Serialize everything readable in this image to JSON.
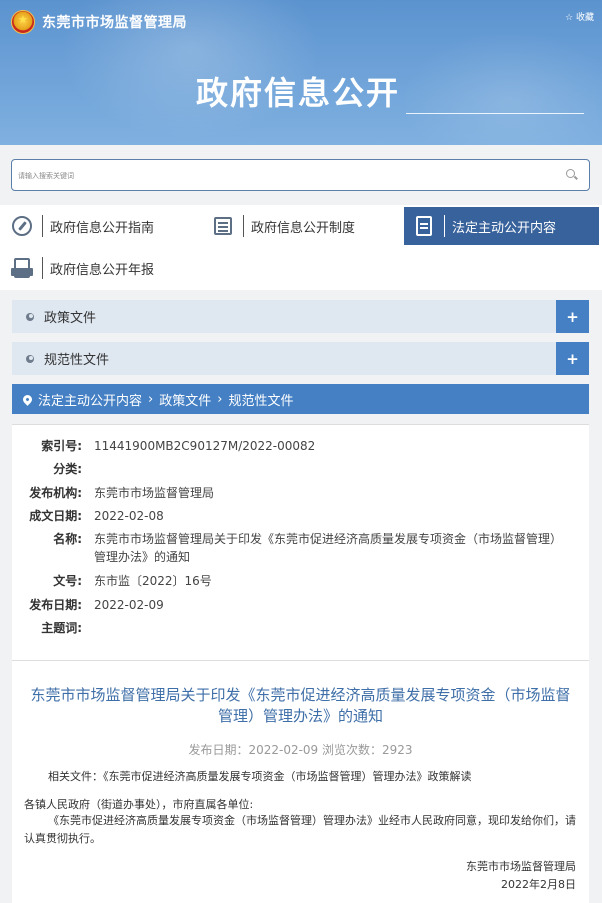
{
  "header": {
    "site_name": "东莞市市场监督管理局",
    "top_link": "☆ 收藏",
    "page_title": "政府信息公开"
  },
  "search": {
    "placeholder": "请输入搜索关键词"
  },
  "quick_links": [
    {
      "label": "政府信息公开指南",
      "icon": "compass-icon"
    },
    {
      "label": "政府信息公开制度",
      "icon": "list-icon"
    },
    {
      "label": "法定主动公开内容",
      "icon": "document-icon",
      "active": true
    },
    {
      "label": "政府信息公开年报",
      "icon": "report-icon"
    }
  ],
  "categories": [
    {
      "label": "政策文件",
      "toggle": "+"
    },
    {
      "label": "规范性文件",
      "toggle": "+"
    }
  ],
  "breadcrumb": [
    "法定主动公开内容",
    "政策文件",
    "规范性文件"
  ],
  "meta": {
    "index_label": "索引号:",
    "index_value": "11441900MB2C90127M/2022-00082",
    "category_label": "分类:",
    "category_value": "",
    "publisher_label": "发布机构:",
    "publisher_value": "东莞市市场监督管理局",
    "made_label": "成文日期:",
    "made_value": "2022-02-08",
    "name_label": "名称:",
    "name_value": "东莞市市场监督管理局关于印发《东莞市促进经济高质量发展专项资金（市场监督管理）管理办法》的通知",
    "docno_label": "文号:",
    "docno_value": "东市监〔2022〕16号",
    "pubdate_label": "发布日期:",
    "pubdate_value": "2022-02-09",
    "keywords_label": "主题词:",
    "keywords_value": ""
  },
  "article": {
    "title": "东莞市市场监督管理局关于印发《东莞市促进经济高质量发展专项资金（市场监督管理）管理办法》的通知",
    "meta_line": "发布日期：2022-02-09   浏览次数：2923",
    "related": "相关文件：《东莞市促进经济高质量发展专项资金（市场监督管理）管理办法》政策解读",
    "salutation": "各镇人民政府（街道办事处），市府直属各单位:",
    "body": "《东莞市促进经济高质量发展专项资金（市场监督管理）管理办法》业经市人民政府同意，现印发给你们，请认真贯彻执行。",
    "signer": "东莞市市场监督管理局",
    "sign_date": "2022年2月8日"
  }
}
